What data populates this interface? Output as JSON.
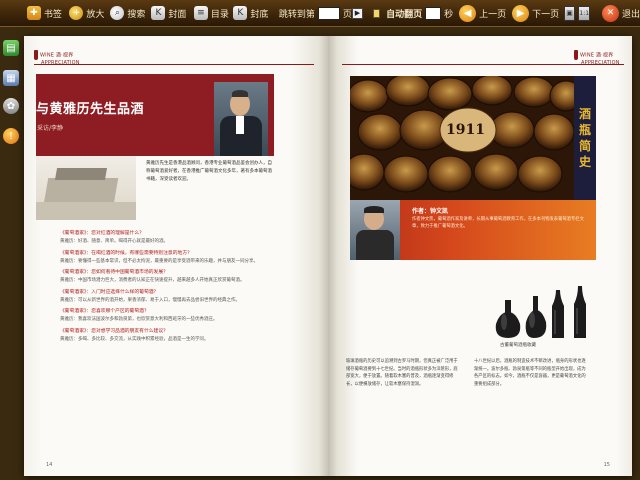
{
  "toolbar": {
    "bookmark": "书签",
    "zoom": "放大",
    "search": "搜索",
    "cover": "封面",
    "toc": "目录",
    "backcover": "封底",
    "jump_prefix": "跳转到第",
    "jump_suffix": "页",
    "auto_flip": "自动翻页",
    "seconds": "秒",
    "prev": "上一页",
    "next": "下一页",
    "ratio": "1:1",
    "exit": "退出"
  },
  "left_page": {
    "magazine": "WINE 酒·视界",
    "magazine_sub": "APPRECIATION",
    "title": "与黄雅历先生品酒",
    "author": "采访/李静",
    "intro": "黄雅历先生是香港品酒顾问，香港专业葡萄酒品鉴会创办人，自称葡萄酒爱好者，在香港推广葡萄酒文化多年，著有多本葡萄酒书籍，深受读者欢迎。",
    "qa": [
      {
        "q": "《葡萄酒家》：您对红酒的理解是什么？",
        "a": "黄雅历：好酒、随意、简单。喝得开心就是最好的酒。"
      },
      {
        "q": "《葡萄酒家》：在喝红酒的时候，有哪些需要特别注意的地方？",
        "a": "黄雅历：要懂得一些基本常识，但不必太拘泥，最重要的是享受酒带来的乐趣，并与朋友一同分享。"
      },
      {
        "q": "《葡萄酒家》：您如何看待中国葡萄酒市场的发展？",
        "a": "黄雅历：中国市场潜力巨大，消费者的认知正在快速提升，越来越多人开始真正欣赏葡萄酒。"
      },
      {
        "q": "《葡萄酒家》：入门时应选择什么样的葡萄酒？",
        "a": "黄雅历：可以从新世界的酒开始，果香浓郁、易于入口，慢慢再去品尝旧世界的经典之作。"
      },
      {
        "q": "《葡萄酒家》：您喜欢哪个产区的葡萄酒？",
        "a": "黄雅历：我喜欢法国波尔多和勃艮第，也欣赏意大利和西班牙的一些优秀酒庄。"
      },
      {
        "q": "《葡萄酒家》：您对想学习品酒的朋友有什么建议？",
        "a": "黄雅历：多喝、多比较、多交流，从实践中积累经验，品酒是一生的学问。"
      }
    ],
    "page_number": "14"
  },
  "right_page": {
    "magazine": "WINE 酒·视界",
    "magazine_sub": "APPRECIATION",
    "title": "酒瓶简史",
    "cellar_year": "1911",
    "author_label": "作者：钟文凯",
    "red_intro": "作者钟文凯，葡萄酒作家及讲师，长期从事葡萄酒教育工作，在多本刊物发表葡萄酒专栏文章，致力于推广葡萄酒文化。",
    "bottle_caption": "古董葡萄酒瓶收藏",
    "body_left": "玻璃酒瓶的历史可以追溯到古罗马时期，但真正被广泛用于储存葡萄酒要到十七世纪。当时的酒瓶形状多为洋葱形，底部宽大，便于放置。随着软木塞的普及，酒瓶逐渐变得修长，以便横放储存，让软木塞保持湿润。",
    "body_right": "十八世纪以后，酒瓶的制造技术不断改进，瓶身的形状也逐渐统一。波尔多瓶、勃艮第瓶等不同的瓶型开始出现，成为各产区的标志。如今，酒瓶不仅是容器，更是葡萄酒文化的重要组成部分。",
    "page_number": "15"
  }
}
